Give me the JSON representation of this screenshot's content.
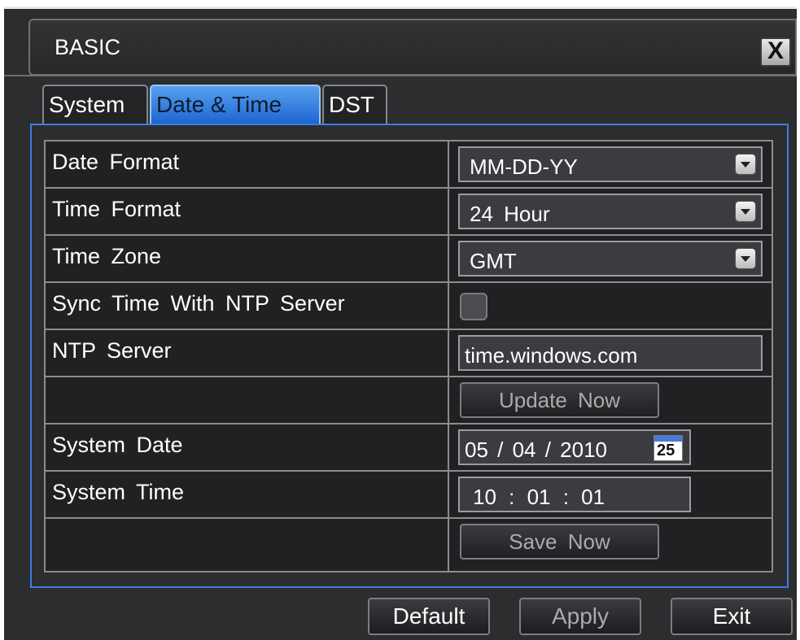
{
  "dialog": {
    "title": "BASIC",
    "close_label": "X"
  },
  "tabs": [
    {
      "label": "System",
      "active": false
    },
    {
      "label": "Date & Time",
      "active": true
    },
    {
      "label": "DST",
      "active": false
    }
  ],
  "settings": {
    "date_format": {
      "label": "Date Format",
      "value": "MM-DD-YY"
    },
    "time_format": {
      "label": "Time Format",
      "value": "24 Hour"
    },
    "time_zone": {
      "label": "Time Zone",
      "value": "GMT"
    },
    "ntp_sync": {
      "label": "Sync Time With NTP Server",
      "checked": false
    },
    "ntp_server": {
      "label": "NTP Server",
      "value": "time.windows.com"
    },
    "update_now": {
      "label": "Update Now"
    },
    "system_date": {
      "label": "System Date",
      "value": "05 / 04 / 2010",
      "calendar_icon_text": "25"
    },
    "system_time": {
      "label": "System Time",
      "value": "10 : 01 : 01"
    },
    "save_now": {
      "label": "Save Now"
    }
  },
  "footer": {
    "default_label": "Default",
    "apply_label": "Apply",
    "exit_label": "Exit"
  },
  "colors": {
    "accent": "#3e7fe0",
    "active_tab": "#2f7ee0",
    "background": "#2b2d2f"
  }
}
